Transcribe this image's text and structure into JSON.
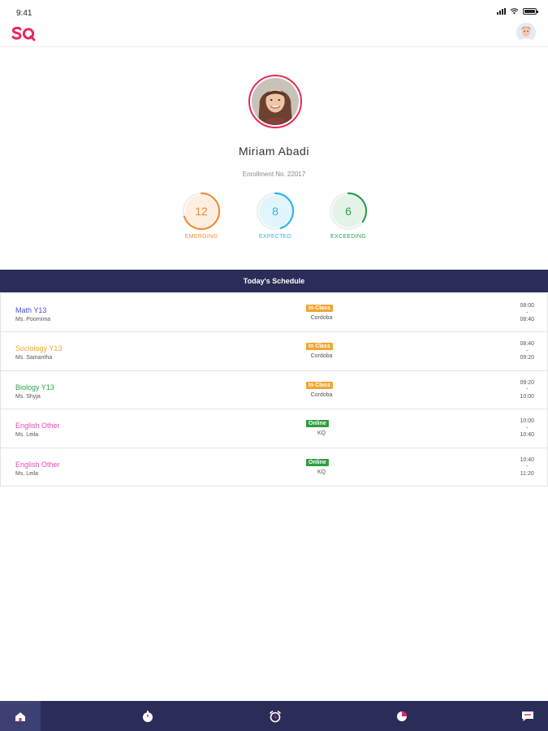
{
  "status_bar": {
    "time": "9:41"
  },
  "header": {
    "logo_icon": "sq-logo-icon",
    "avatar_icon": "user-avatar-icon"
  },
  "profile": {
    "name": "Miriam Abadi",
    "enrollment": "Enrollment No. 22017"
  },
  "stats": [
    {
      "value": "12",
      "label": "EMERGING",
      "color": "#f28c38",
      "bg": "#fdeee0",
      "progress": 0.7
    },
    {
      "value": "8",
      "label": "EXPECTED",
      "color": "#29b6e8",
      "bg": "#e2f5fc",
      "progress": 0.45
    },
    {
      "value": "6",
      "label": "EXCEEDING",
      "color": "#2e9e4f",
      "bg": "#e3f3e7",
      "progress": 0.35
    }
  ],
  "schedule": {
    "title": "Today's Schedule",
    "rows": [
      {
        "subject": "Math Y13",
        "teacher": "Ms. Poornima",
        "mode": "In Class",
        "location": "Cordoba",
        "start": "08:00",
        "sep": "-",
        "end": "08:40",
        "subject_color": "#4a4fd0",
        "mode_color": "#f2a531"
      },
      {
        "subject": "Sociology Y13",
        "teacher": "Ms. Samantha",
        "mode": "In Class",
        "location": "Cordoba",
        "start": "08:40",
        "sep": "-",
        "end": "09:20",
        "subject_color": "#f2a531",
        "mode_color": "#f2a531"
      },
      {
        "subject": "Biology Y13",
        "teacher": "Ms. Shyja",
        "mode": "In Class",
        "location": "Cordoba",
        "start": "09:20",
        "sep": "-",
        "end": "10:00",
        "subject_color": "#2e9e4f",
        "mode_color": "#f2a531"
      },
      {
        "subject": "English Other",
        "teacher": "Ms. Leila",
        "mode": "Online",
        "location": "KQ",
        "start": "10:00",
        "sep": "-",
        "end": "10:40",
        "subject_color": "#e84bb4",
        "mode_color": "#2e9e3f"
      },
      {
        "subject": "English Other",
        "teacher": "Ms. Leila",
        "mode": "Online",
        "location": "KQ",
        "start": "10:40",
        "sep": "-",
        "end": "11:20",
        "subject_color": "#e84bb4",
        "mode_color": "#2e9e3f"
      }
    ]
  },
  "tab_bar": {
    "tabs": [
      {
        "icon": "home-icon",
        "active": true
      },
      {
        "icon": "stopwatch-icon",
        "active": false
      },
      {
        "icon": "alarm-clock-icon",
        "active": false
      },
      {
        "icon": "pie-chart-icon",
        "active": false
      },
      {
        "icon": "message-icon",
        "active": false
      }
    ]
  }
}
